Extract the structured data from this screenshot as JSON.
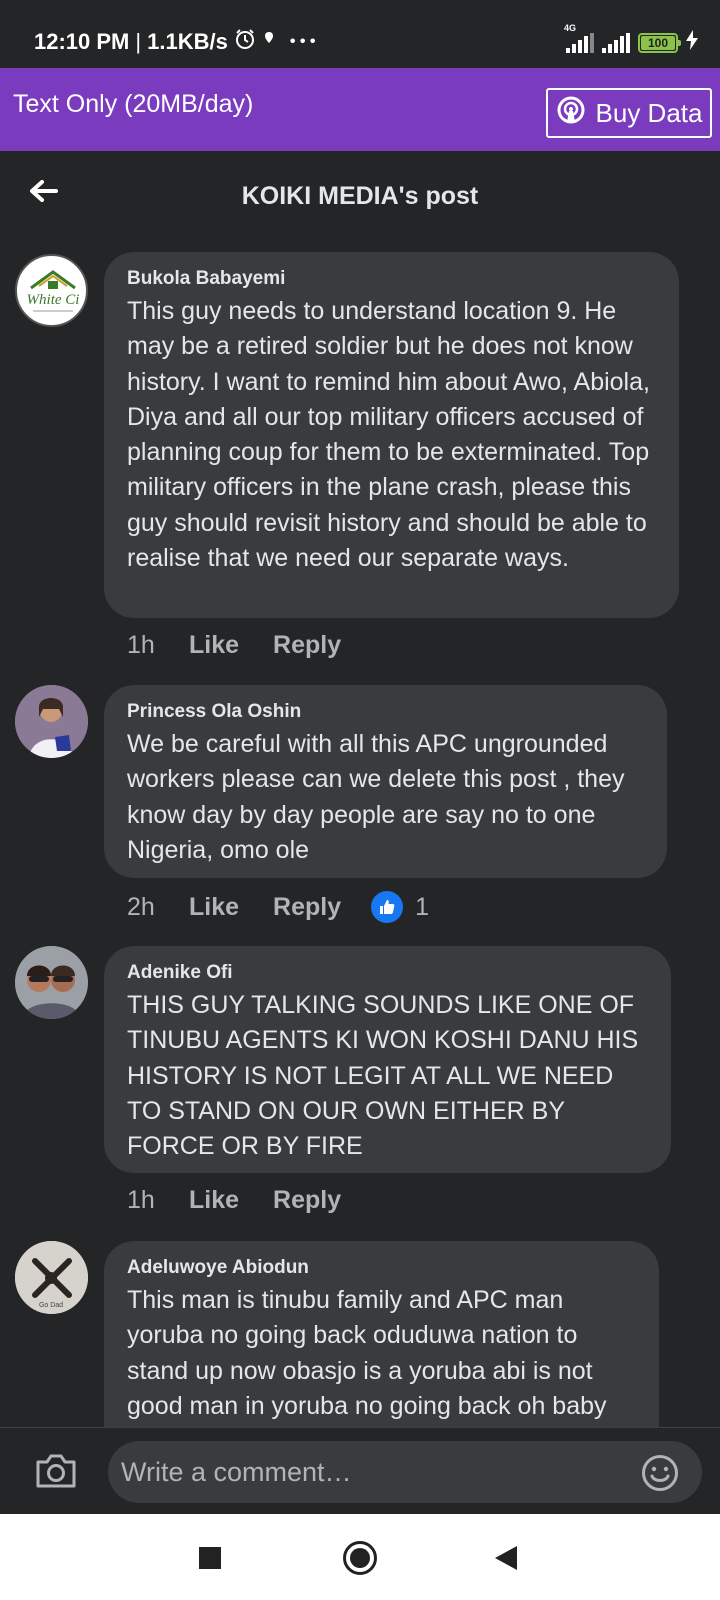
{
  "status_bar": {
    "time": "12:10 PM",
    "separator": "|",
    "speed": "1.1KB/s",
    "more": "• • •",
    "network_label": "4G",
    "battery": "100"
  },
  "data_plan": {
    "label": "Text Only (20MB/day)",
    "buy_label": "Buy Data"
  },
  "header": {
    "title": "KOIKI MEDIA's post"
  },
  "comments": [
    {
      "author": "Bukola Babayemi",
      "text": "This guy needs to understand location 9. He may be a retired soldier but he does not know history. I want to remind him about Awo, Abiola, Diya and all our top military officers accused of planning coup for them to be exterminated. Top military officers in the plane crash, please this guy should revisit history and should be able to realise that we need our separate ways.",
      "time": "1h",
      "like_label": "Like",
      "reply_label": "Reply"
    },
    {
      "author": "Princess Ola Oshin",
      "text": "We be careful with all this APC ungrounded workers please can we delete this post , they know day by day people are say no to one Nigeria, omo ole",
      "time": "2h",
      "like_label": "Like",
      "reply_label": "Reply",
      "reaction_count": "1"
    },
    {
      "author": "Adenike Ofi",
      "text": "THIS GUY TALKING SOUNDS LIKE ONE OF TINUBU AGENTS KI WON KOSHI DANU HIS HISTORY IS NOT LEGIT AT ALL WE NEED TO STAND ON OUR OWN EITHER BY FORCE OR BY FIRE",
      "time": "1h",
      "like_label": "Like",
      "reply_label": "Reply"
    },
    {
      "author": "Adeluwoye Abiodun",
      "text": "This man is tinubu family and APC man yoruba no going back oduduwa nation to stand up now obasjo is a yoruba abi is not good man in yoruba no going back oh baby"
    }
  ],
  "avatar_text": {
    "white_city": "White Ci",
    "go_dad": "Go Dad"
  },
  "composer": {
    "placeholder": "Write a comment…"
  },
  "colors": {
    "data_bar": "#7b3bbf",
    "background": "#242526",
    "bubble": "#3a3b3c",
    "like_blue": "#1877f2",
    "battery_green": "#8bc34a"
  },
  "icons": [
    "clock-icon",
    "location-icon",
    "signal-icon",
    "battery-icon",
    "charging-icon",
    "broadcast-icon",
    "back-arrow-icon",
    "like-icon",
    "camera-icon",
    "emoji-icon",
    "square-icon",
    "circle-icon",
    "triangle-icon"
  ]
}
